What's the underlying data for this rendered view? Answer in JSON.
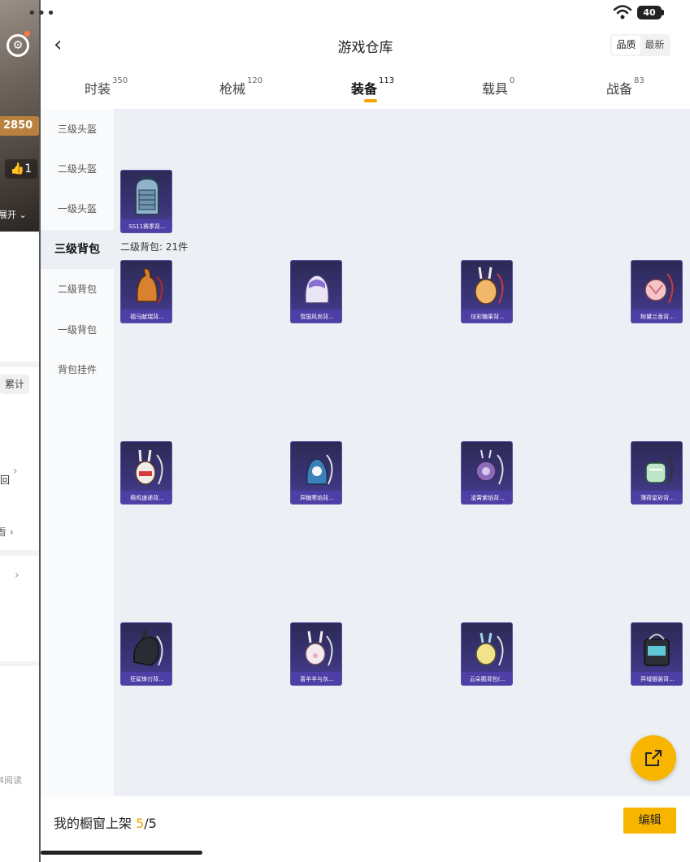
{
  "left_panel": {
    "coins": "2850",
    "likes": "1",
    "expand_label": "展开",
    "total_label": "累计",
    "item_char": "回",
    "view_label": "看",
    "reads_label": "4阅读"
  },
  "status_bar": {
    "battery": "40"
  },
  "header": {
    "title": "游戏仓库",
    "sort_quality": "品质",
    "sort_new": "最新"
  },
  "tabs": [
    {
      "label": "时装",
      "count": "350"
    },
    {
      "label": "枪械",
      "count": "120"
    },
    {
      "label": "装备",
      "count": "113"
    },
    {
      "label": "载具",
      "count": "0"
    },
    {
      "label": "战备",
      "count": "83"
    }
  ],
  "sidebar": [
    "三级头盔",
    "二级头盔",
    "一级头盔",
    "三级背包",
    "二级背包",
    "一级背包",
    "背包挂件"
  ],
  "content": {
    "featured_item": "SS11赛季背...",
    "count_label": "二级背包: 21件",
    "items": [
      "福马献瑞背...",
      "雪国风尚背...",
      "炫彩糖果背...",
      "粉黛兰香背...",
      "萌鸡速递背...",
      "异糖寒焰背...",
      "凌霄紫焰背...",
      "薄荷星砂背...",
      "狂鲨锋刃背...",
      "喜羊羊与灰...",
      "云朵鹅背包(...",
      "异域银装背..."
    ]
  },
  "footer": {
    "showcase_prefix": "我的橱窗上架 ",
    "showcase_count": "5",
    "showcase_total": "/5",
    "edit_label": "编辑"
  },
  "colors": {
    "accent": "#f7b500",
    "item_bg": "#3a3478",
    "content_bg": "#eceff3"
  }
}
